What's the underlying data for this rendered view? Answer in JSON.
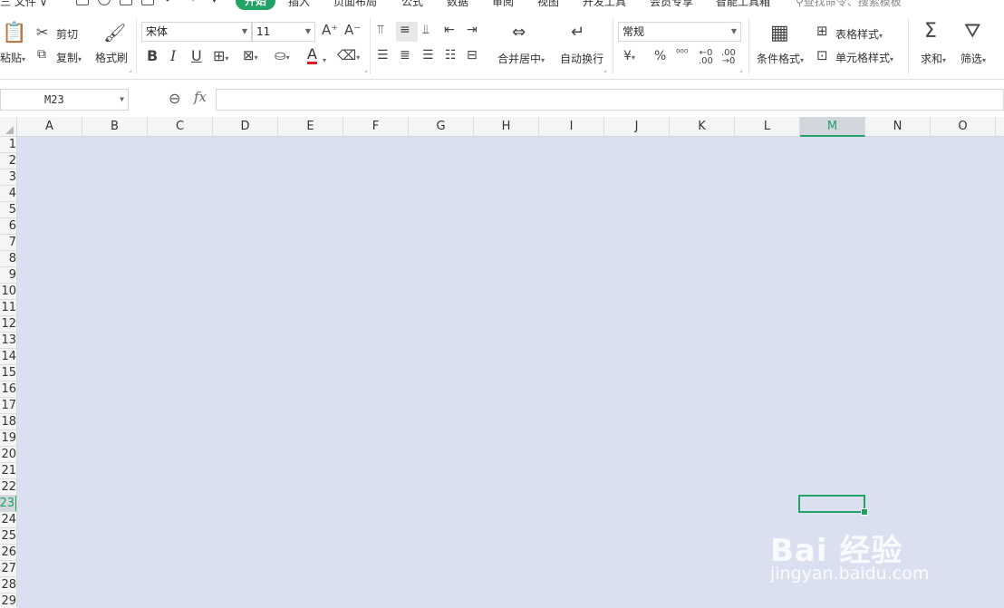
{
  "menubar": {
    "file_label": "三 文件 ∨",
    "tabs": [
      "开始",
      "插入",
      "页面布局",
      "公式",
      "数据",
      "审阅",
      "视图",
      "开发工具",
      "会员专享",
      "智能工具箱"
    ],
    "search_placeholder": "查找命令、搜索模板"
  },
  "ribbon": {
    "paste": "粘贴",
    "cut": "剪切",
    "copy": "复制",
    "format_painter": "格式刷",
    "font_name": "宋体",
    "font_size": "11",
    "merge_center": "合并居中",
    "wrap_text": "自动换行",
    "number_format": "常规",
    "conditional_format": "条件格式",
    "table_style": "表格样式",
    "cell_style": "单元格样式",
    "sum": "求和",
    "filter": "筛选"
  },
  "formula_bar": {
    "name_box": "M23",
    "fx": "fx",
    "content": ""
  },
  "grid": {
    "columns": [
      "A",
      "B",
      "C",
      "D",
      "E",
      "F",
      "G",
      "H",
      "I",
      "J",
      "K",
      "L",
      "M",
      "N",
      "O"
    ],
    "active_column": "M",
    "rows": [
      "1",
      "2",
      "3",
      "4",
      "5",
      "6",
      "7",
      "8",
      "9",
      "10",
      "11",
      "12",
      "13",
      "14",
      "15",
      "16",
      "17",
      "18",
      "19",
      "20",
      "21",
      "22",
      "23",
      "24",
      "25",
      "26",
      "27",
      "28",
      "29"
    ],
    "active_row": "23",
    "fill_color": "#dbe0f1",
    "accent_color": "#21a366"
  },
  "watermark": {
    "brand": "Bai 经验",
    "url": "jingyan.baidu.com"
  }
}
